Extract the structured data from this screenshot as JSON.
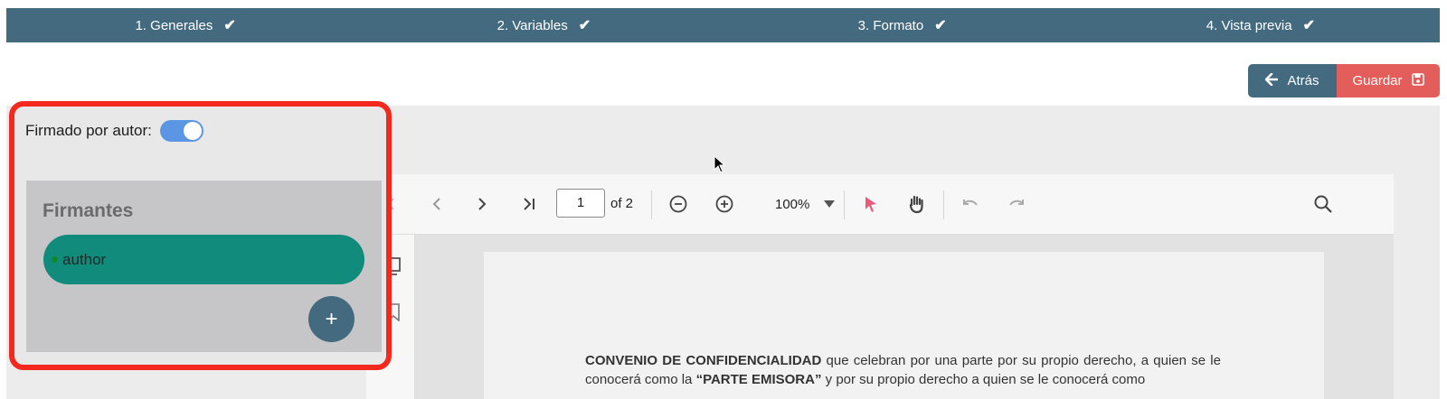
{
  "stepper": {
    "steps": [
      {
        "label": "1. Generales"
      },
      {
        "label": "2. Variables"
      },
      {
        "label": "3. Formato"
      },
      {
        "label": "4. Vista previa"
      }
    ],
    "check_glyph": "✔"
  },
  "actions": {
    "back_label": "Atrás",
    "save_label": "Guardar"
  },
  "signing": {
    "toggle_label": "Firmado por autor:",
    "toggle_on": true,
    "section_title": "Firmantes",
    "signers": [
      {
        "name": "author"
      }
    ],
    "add_label": "+"
  },
  "viewer": {
    "page_value": "1",
    "of_label": "of 2",
    "zoom_label": "100%",
    "doc_bold_1": "CONVENIO DE CONFIDENCIALIDAD",
    "doc_text_1": " que celebran por una parte por su propio derecho, a quien se le conocerá como la ",
    "doc_bold_2": "“PARTE EMISORA”",
    "doc_text_2": " y por su propio derecho a quien se le conocerá como"
  },
  "colors": {
    "primary": "#446a80",
    "danger": "#e35d5a",
    "highlight": "#f5281e",
    "signer_pill": "#118b7c",
    "toggle": "#5b96e4",
    "select_tool": "#e85a7a"
  }
}
